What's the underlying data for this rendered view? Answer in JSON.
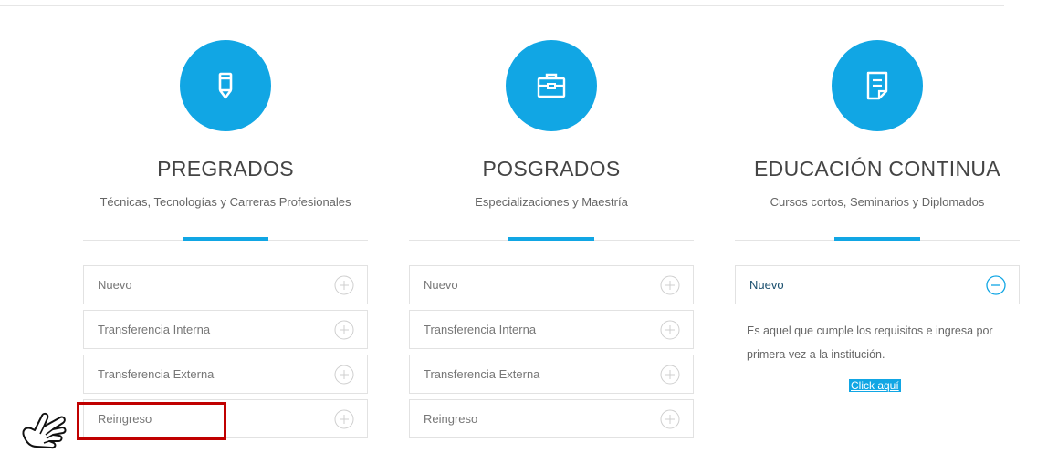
{
  "colors": {
    "accent": "#11a6e4",
    "highlight": "#c00000"
  },
  "programs": [
    {
      "title": "PREGRADOS",
      "subtitle": "Técnicas, Tecnologías y Carreras Profesionales",
      "icon": "pencil-icon",
      "options": [
        "Nuevo",
        "Transferencia Interna",
        "Transferencia Externa",
        "Reingreso"
      ]
    },
    {
      "title": "POSGRADOS",
      "subtitle": "Especializaciones y Maestría",
      "icon": "briefcase-icon",
      "options": [
        "Nuevo",
        "Transferencia Interna",
        "Transferencia Externa",
        "Reingreso"
      ]
    },
    {
      "title": "EDUCACIÓN CONTINUA",
      "subtitle": "Cursos cortos, Seminarios y Diplomados",
      "icon": "document-icon",
      "options": [
        "Nuevo"
      ],
      "expanded_description": "Es aquel que cumple los requisitos e ingresa por primera vez a la institución.",
      "cta_label": "Click aquí"
    }
  ]
}
